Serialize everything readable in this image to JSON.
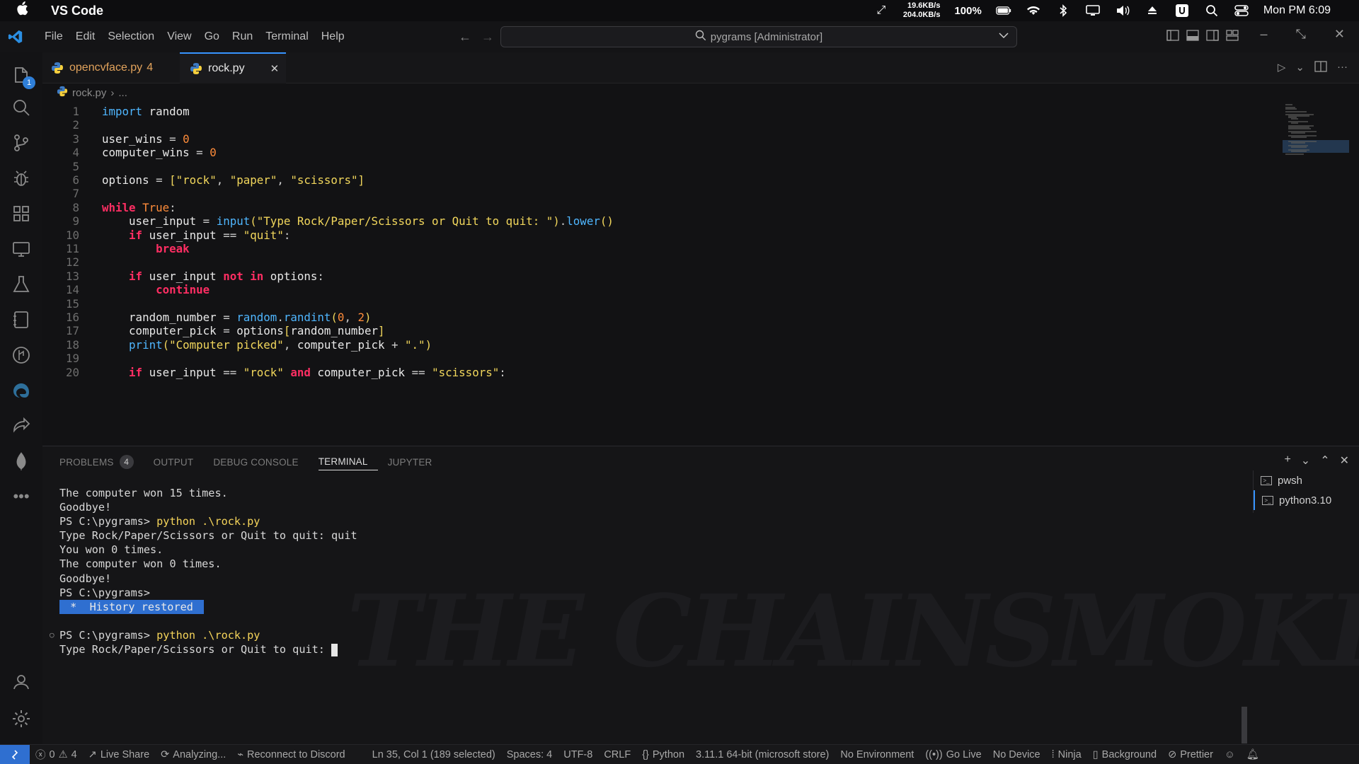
{
  "menubar": {
    "app_name": "VS Code",
    "net_up": "19.6KB/s",
    "net_down": "204.0KB/s",
    "battery": "100%",
    "clock": "Mon PM 6:09"
  },
  "titlebar": {
    "menu": [
      "File",
      "Edit",
      "Selection",
      "View",
      "Go",
      "Run",
      "Terminal",
      "Help"
    ],
    "search_text": "pygrams [Administrator]"
  },
  "activity": {
    "explorer_badge": "1"
  },
  "tabs": [
    {
      "label": "opencvface.py",
      "problems": "4"
    },
    {
      "label": "rock.py"
    }
  ],
  "breadcrumb": {
    "file": "rock.py",
    "rest": "..."
  },
  "editor": {
    "lines": [
      {
        "n": "1",
        "tokens": [
          [
            "kw2",
            "import"
          ],
          [
            "tx",
            " random"
          ]
        ]
      },
      {
        "n": "2",
        "tokens": []
      },
      {
        "n": "3",
        "tokens": [
          [
            "tx",
            "user_wins "
          ],
          [
            "op",
            "= "
          ],
          [
            "num",
            "0"
          ]
        ]
      },
      {
        "n": "4",
        "tokens": [
          [
            "tx",
            "computer_wins "
          ],
          [
            "op",
            "= "
          ],
          [
            "num",
            "0"
          ]
        ]
      },
      {
        "n": "5",
        "tokens": []
      },
      {
        "n": "6",
        "tokens": [
          [
            "tx",
            "options "
          ],
          [
            "op",
            "= "
          ],
          [
            "brk",
            "["
          ],
          [
            "str",
            "\"rock\""
          ],
          [
            "op",
            ", "
          ],
          [
            "str",
            "\"paper\""
          ],
          [
            "op",
            ", "
          ],
          [
            "str",
            "\"scissors\""
          ],
          [
            "brk",
            "]"
          ]
        ]
      },
      {
        "n": "7",
        "tokens": []
      },
      {
        "n": "8",
        "tokens": [
          [
            "kw",
            "while"
          ],
          [
            "tx",
            " "
          ],
          [
            "num",
            "True"
          ],
          [
            "op",
            ":"
          ]
        ]
      },
      {
        "n": "9",
        "tokens": [
          [
            "tx",
            "    user_input "
          ],
          [
            "op",
            "= "
          ],
          [
            "fn",
            "input"
          ],
          [
            "brk",
            "("
          ],
          [
            "str",
            "\"Type Rock/Paper/Scissors or Quit to quit: \""
          ],
          [
            "brk",
            ")"
          ],
          [
            "op",
            "."
          ],
          [
            "fn",
            "lower"
          ],
          [
            "brk",
            "()"
          ]
        ]
      },
      {
        "n": "10",
        "tokens": [
          [
            "tx",
            "    "
          ],
          [
            "kw",
            "if"
          ],
          [
            "tx",
            " user_input "
          ],
          [
            "op",
            "== "
          ],
          [
            "str",
            "\"quit\""
          ],
          [
            "op",
            ":"
          ]
        ]
      },
      {
        "n": "11",
        "tokens": [
          [
            "tx",
            "        "
          ],
          [
            "kw",
            "break"
          ]
        ]
      },
      {
        "n": "12",
        "tokens": []
      },
      {
        "n": "13",
        "tokens": [
          [
            "tx",
            "    "
          ],
          [
            "kw",
            "if"
          ],
          [
            "tx",
            " user_input "
          ],
          [
            "kw",
            "not in"
          ],
          [
            "tx",
            " options"
          ],
          [
            "op",
            ":"
          ]
        ]
      },
      {
        "n": "14",
        "tokens": [
          [
            "tx",
            "        "
          ],
          [
            "kw",
            "continue"
          ]
        ]
      },
      {
        "n": "15",
        "tokens": []
      },
      {
        "n": "16",
        "tokens": [
          [
            "tx",
            "    random_number "
          ],
          [
            "op",
            "= "
          ],
          [
            "fn",
            "random"
          ],
          [
            "op",
            "."
          ],
          [
            "fn",
            "randint"
          ],
          [
            "brk",
            "("
          ],
          [
            "num",
            "0"
          ],
          [
            "op",
            ", "
          ],
          [
            "num",
            "2"
          ],
          [
            "brk",
            ")"
          ]
        ]
      },
      {
        "n": "17",
        "tokens": [
          [
            "tx",
            "    computer_pick "
          ],
          [
            "op",
            "= "
          ],
          [
            "tx",
            "options"
          ],
          [
            "brk",
            "["
          ],
          [
            "tx",
            "random_number"
          ],
          [
            "brk",
            "]"
          ]
        ]
      },
      {
        "n": "18",
        "tokens": [
          [
            "tx",
            "    "
          ],
          [
            "fn",
            "print"
          ],
          [
            "brk",
            "("
          ],
          [
            "str",
            "\"Computer picked\""
          ],
          [
            "op",
            ", "
          ],
          [
            "tx",
            "computer_pick "
          ],
          [
            "op",
            "+ "
          ],
          [
            "str",
            "\".\""
          ],
          [
            "brk",
            ")"
          ]
        ]
      },
      {
        "n": "19",
        "tokens": []
      },
      {
        "n": "20",
        "tokens": [
          [
            "tx",
            "    "
          ],
          [
            "kw",
            "if"
          ],
          [
            "tx",
            " user_input "
          ],
          [
            "op",
            "== "
          ],
          [
            "str",
            "\"rock\""
          ],
          [
            "tx",
            " "
          ],
          [
            "kw",
            "and"
          ],
          [
            "tx",
            " computer_pick "
          ],
          [
            "op",
            "== "
          ],
          [
            "str",
            "\"scissors\""
          ],
          [
            "op",
            ":"
          ]
        ]
      }
    ]
  },
  "panel": {
    "tabs": [
      "PROBLEMS",
      "OUTPUT",
      "DEBUG CONSOLE",
      "TERMINAL",
      "JUPYTER"
    ],
    "problems_count": "4",
    "terminal_lines": [
      {
        "text": "The computer won 15 times."
      },
      {
        "text": "Goodbye!"
      },
      {
        "prompt": "PS C:\\pygrams> ",
        "cmd": "python .\\rock.py"
      },
      {
        "text": "Type Rock/Paper/Scissors or Quit to quit: quit"
      },
      {
        "text": "You won 0 times."
      },
      {
        "text": "The computer won 0 times."
      },
      {
        "text": "Goodbye!"
      },
      {
        "text": "PS C:\\pygrams>"
      },
      {
        "hist": " *  History restored "
      },
      {
        "text": ""
      },
      {
        "prompt": "PS C:\\pygrams> ",
        "cmd": "python .\\rock.py"
      },
      {
        "text": "Type Rock/Paper/Scissors or Quit to quit: ",
        "cursor": true
      }
    ],
    "terminals": [
      "pwsh",
      "python3.10"
    ],
    "watermark": "THE CHAINSMOKERS"
  },
  "statusbar": {
    "errors": "0",
    "warnings": "4",
    "live_share": "Live Share",
    "analyzing": "Analyzing...",
    "discord": "Reconnect to Discord",
    "position": "Ln 35, Col 1 (189 selected)",
    "spaces": "Spaces: 4",
    "encoding": "UTF-8",
    "eol": "CRLF",
    "language": "Python",
    "interpreter": "3.11.1 64-bit (microsoft store)",
    "env": "No Environment",
    "golive": "Go Live",
    "device": "No Device",
    "ninja": "Ninja",
    "background": "Background",
    "prettier": "Prettier"
  },
  "colors": {
    "accent": "#3794ff",
    "keyword": "#ff2e63",
    "string": "#f2d75c",
    "function": "#4fb6ff",
    "number": "#ff8c3a"
  }
}
